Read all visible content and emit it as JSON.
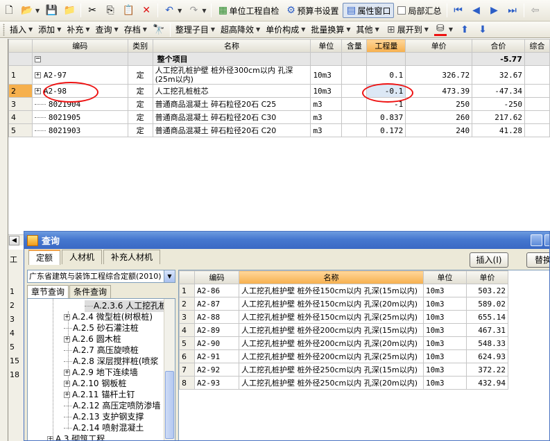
{
  "toolbar1": {
    "self_check": "单位工程自检",
    "budget_settings": "预算书设置",
    "property_window": "属性窗口",
    "partial_summary": "局部汇总"
  },
  "toolbar2": {
    "insert": "插入",
    "add": "添加",
    "supplement": "补充",
    "query": "查询",
    "archive": "存档",
    "organize": "整理子目",
    "height_cost": "超高降效",
    "unit_price": "单价构成",
    "batch_convert": "批量换算",
    "other": "其他",
    "expand": "展开到"
  },
  "main_grid": {
    "headers": [
      "编码",
      "类别",
      "名称",
      "单位",
      "含量",
      "工程量",
      "单价",
      "合价",
      "综合"
    ],
    "group": {
      "label": "整个项目",
      "total": "-5.77"
    },
    "rows": [
      {
        "num": "1",
        "code": "A2-97",
        "type": "定",
        "name": "人工挖孔桩护壁 桩外径300cm以内 孔深(25m以内)",
        "unit": "10m3",
        "qty": "0.1",
        "price": "326.72",
        "total": "32.67"
      },
      {
        "num": "2",
        "code": "A2-98",
        "type": "定",
        "name": "人工挖孔桩桩芯",
        "unit": "10m3",
        "qty": "-0.1",
        "price": "473.39",
        "total": "-47.34"
      },
      {
        "num": "3",
        "code": "8021904",
        "type": "定",
        "name": "普通商品混凝土 碎石粒径20石 C25",
        "unit": "m3",
        "qty": "-1",
        "price": "250",
        "total": "-250"
      },
      {
        "num": "4",
        "code": "8021905",
        "type": "定",
        "name": "普通商品混凝土 碎石粒径20石 C30",
        "unit": "m3",
        "qty": "0.837",
        "price": "260",
        "total": "217.62"
      },
      {
        "num": "5",
        "code": "8021903",
        "type": "定",
        "name": "普通商品混凝土 碎石粒径20石 C20",
        "unit": "m3",
        "qty": "0.172",
        "price": "240",
        "total": "41.28"
      }
    ]
  },
  "left_strip": {
    "tab": "工",
    "rows": [
      "1",
      "2",
      "3",
      "4",
      "5",
      "15",
      "18"
    ]
  },
  "query_window": {
    "title": "查询",
    "tabs": [
      "定额",
      "人材机",
      "补充人材机"
    ],
    "insert_button": "插入(I)",
    "replace_button": "替换",
    "quota_library": "广东省建筑与装饰工程综合定额(2010)",
    "sub_tabs": [
      "章节查询",
      "条件查询"
    ],
    "tree": [
      {
        "label": "A.2.3.6 人工挖孔桩",
        "level": 2,
        "box": "",
        "sel": true
      },
      {
        "label": "A.2.4 微型桩(树根桩)",
        "level": 1,
        "box": "+"
      },
      {
        "label": "A.2.5 砂石灌注桩",
        "level": 1,
        "box": ""
      },
      {
        "label": "A.2.6 圆木桩",
        "level": 1,
        "box": "+"
      },
      {
        "label": "A.2.7 高压旋喷桩",
        "level": 1,
        "box": ""
      },
      {
        "label": "A.2.8 深层搅拌桩(喷浆",
        "level": 1,
        "box": ""
      },
      {
        "label": "A.2.9 地下连续墙",
        "level": 1,
        "box": "+"
      },
      {
        "label": "A.2.10 钢板桩",
        "level": 1,
        "box": "+"
      },
      {
        "label": "A.2.11 锚杆土钉",
        "level": 1,
        "box": "+"
      },
      {
        "label": "A.2.12 高压定喷防渗墙",
        "level": 1,
        "box": ""
      },
      {
        "label": "A.2.13 支护钢支撑",
        "level": 1,
        "box": ""
      },
      {
        "label": "A.2.14 喷射混凝土",
        "level": 1,
        "box": ""
      },
      {
        "label": "A.3 砌筑工程",
        "level": 0,
        "box": "+"
      }
    ],
    "results_headers": [
      "编码",
      "名称",
      "单位",
      "单价"
    ],
    "results": [
      {
        "num": "1",
        "code": "A2-86",
        "name": "人工挖孔桩护壁 桩外径150cm以内 孔深(15m以内)",
        "unit": "10m3",
        "price": "503.22"
      },
      {
        "num": "2",
        "code": "A2-87",
        "name": "人工挖孔桩护壁 桩外径150cm以内 孔深(20m以内)",
        "unit": "10m3",
        "price": "589.02"
      },
      {
        "num": "3",
        "code": "A2-88",
        "name": "人工挖孔桩护壁 桩外径150cm以内 孔深(25m以内)",
        "unit": "10m3",
        "price": "655.14"
      },
      {
        "num": "4",
        "code": "A2-89",
        "name": "人工挖孔桩护壁 桩外径200cm以内 孔深(15m以内)",
        "unit": "10m3",
        "price": "467.31"
      },
      {
        "num": "5",
        "code": "A2-90",
        "name": "人工挖孔桩护壁 桩外径200cm以内 孔深(20m以内)",
        "unit": "10m3",
        "price": "548.33"
      },
      {
        "num": "6",
        "code": "A2-91",
        "name": "人工挖孔桩护壁 桩外径200cm以内 孔深(25m以内)",
        "unit": "10m3",
        "price": "624.93"
      },
      {
        "num": "7",
        "code": "A2-92",
        "name": "人工挖孔桩护壁 桩外径250cm以内 孔深(15m以内)",
        "unit": "10m3",
        "price": "372.22"
      },
      {
        "num": "8",
        "code": "A2-93",
        "name": "人工挖孔桩护壁 桩外径250cm以内 孔深(20m以内)",
        "unit": "10m3",
        "price": "432.94"
      }
    ]
  },
  "colors": {
    "accent": "#f6b04d",
    "annotation": "#ee1111",
    "title_bar": "#4577cf"
  }
}
